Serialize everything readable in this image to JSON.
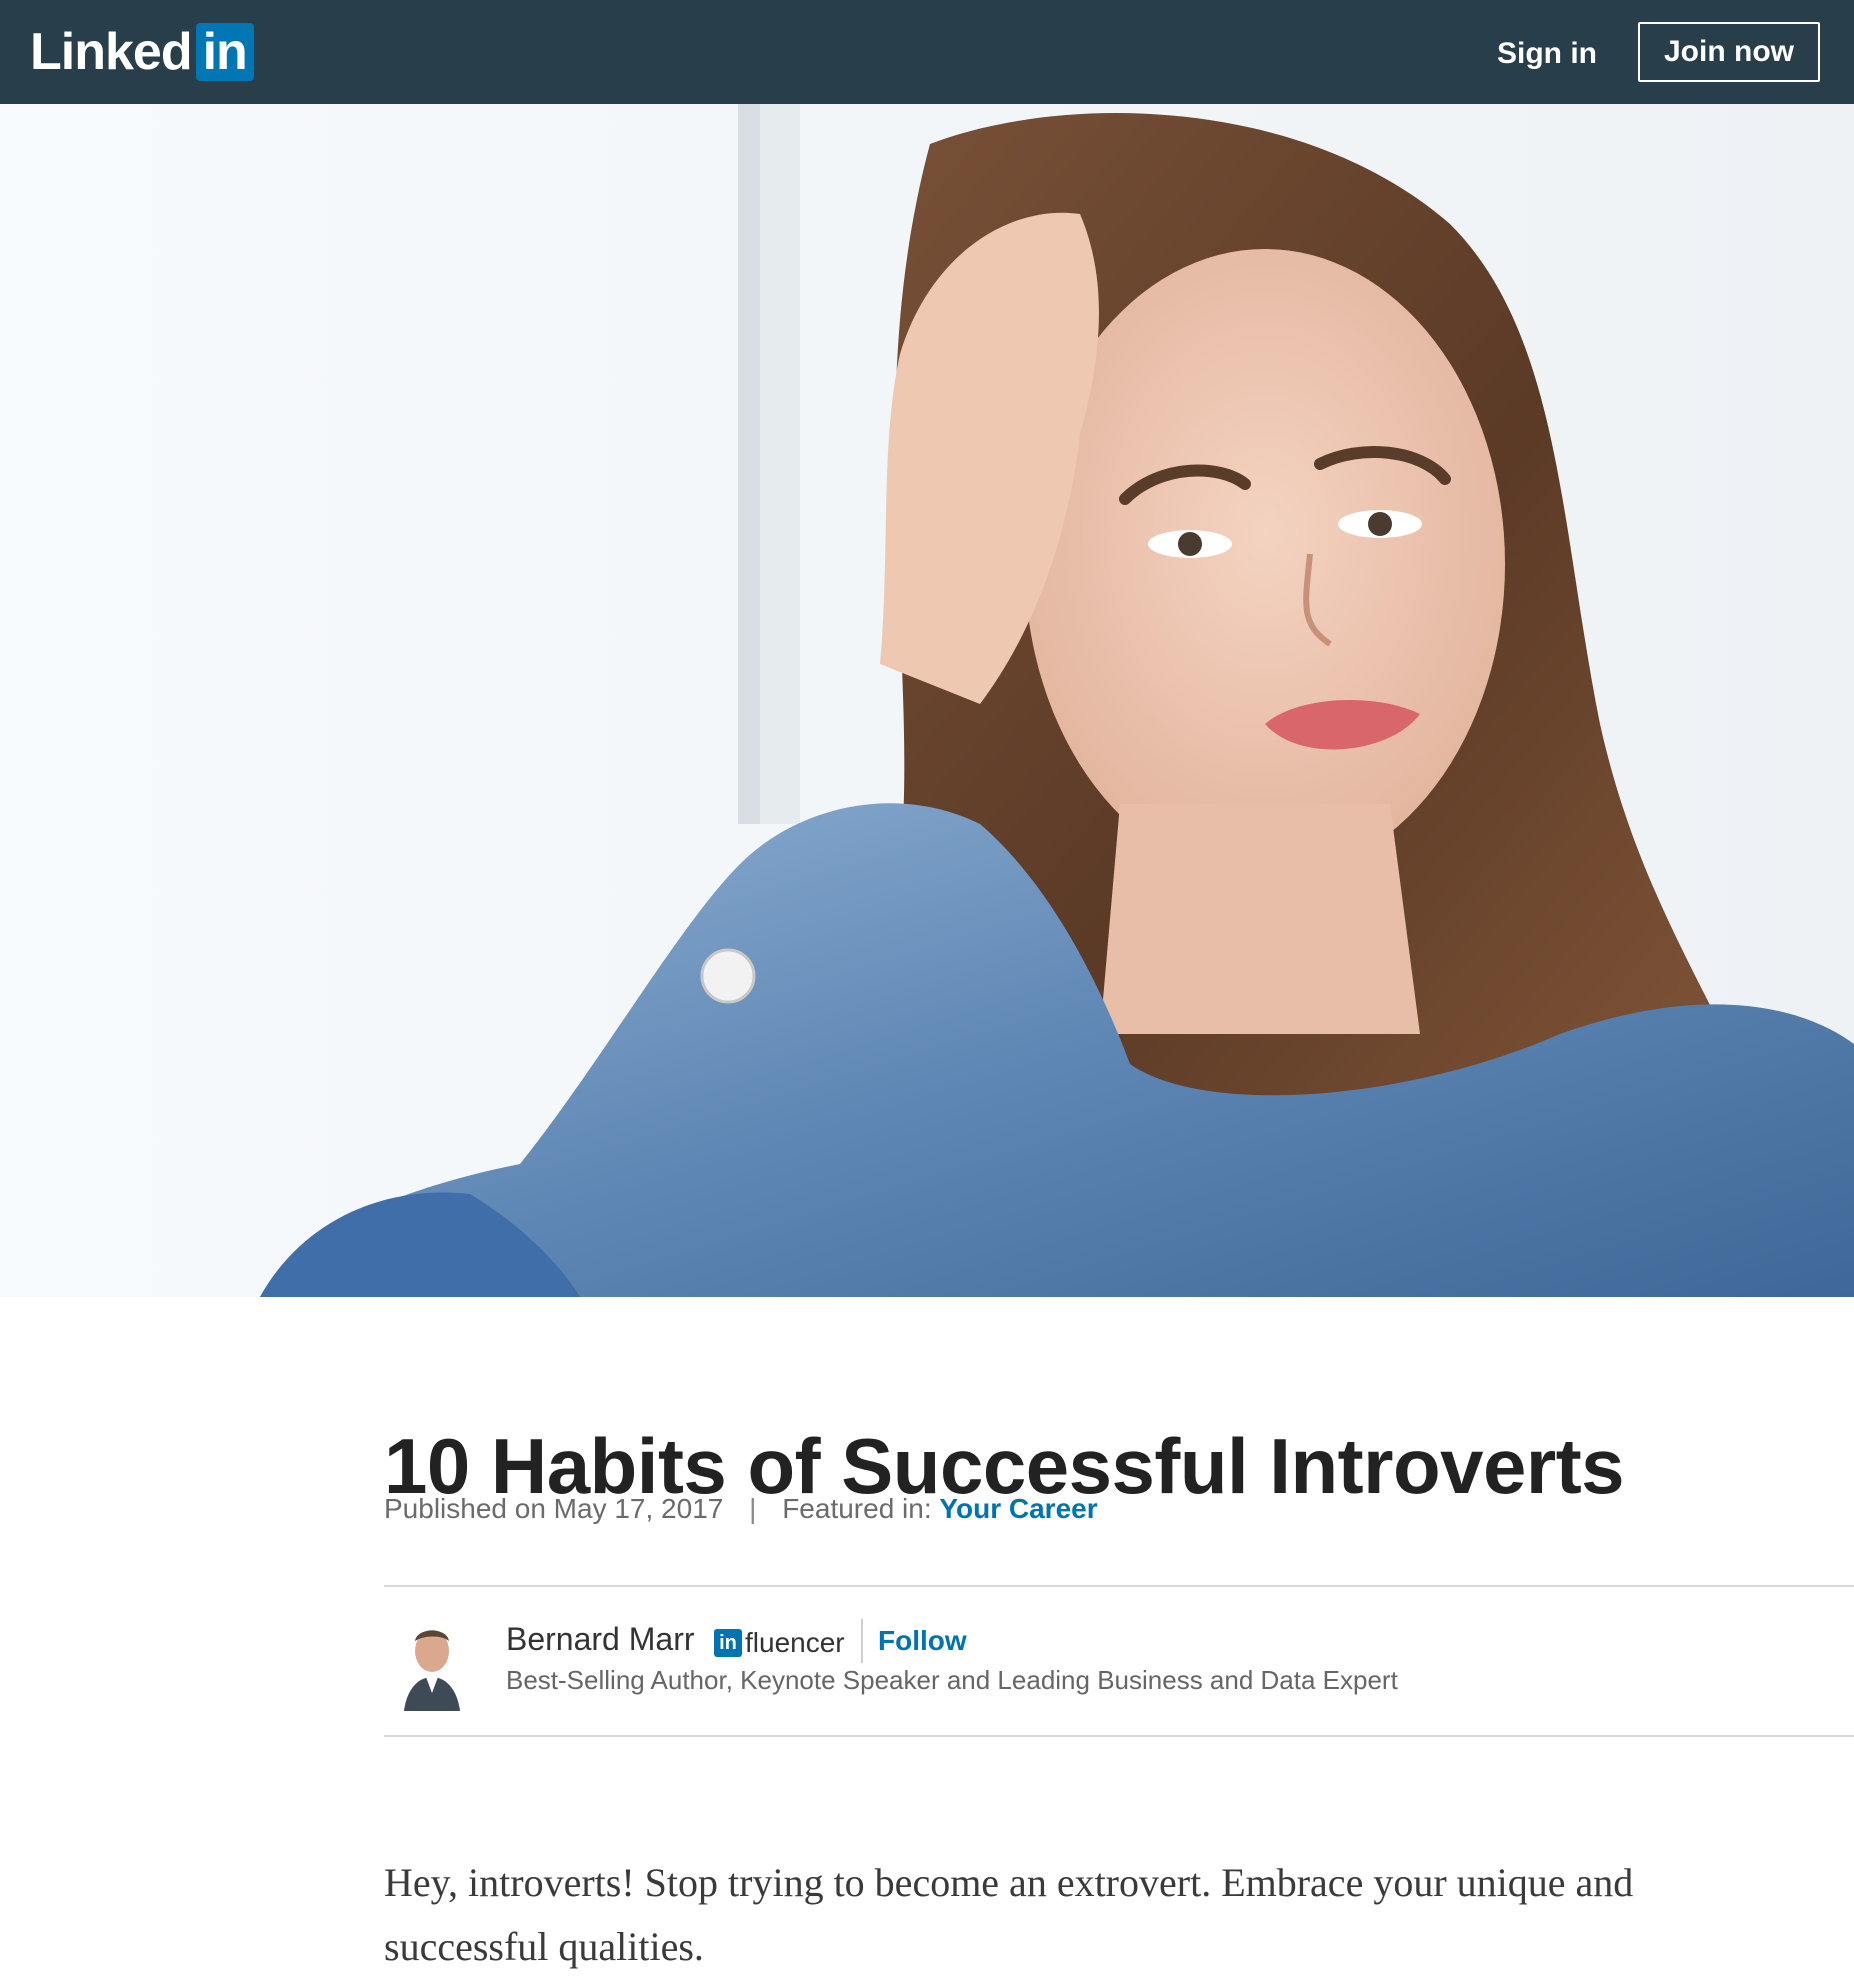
{
  "header": {
    "logo_text": "Linked",
    "logo_box_text": "in",
    "sign_in_label": "Sign in",
    "join_now_label": "Join now",
    "bar_color": "#283e4a",
    "brand_blue": "#0073b1"
  },
  "article": {
    "title": "10 Habits of Successful Introverts",
    "published": "Published on May 17, 2017",
    "separator": "|",
    "featured_label": "Featured in:",
    "featured_link": "Your Career"
  },
  "author": {
    "name": "Bernard Marr",
    "badge_box_text": "in",
    "badge_text": "fluencer",
    "follow_label": "Follow",
    "headline": "Best-Selling Author, Keynote Speaker and Leading Business and Data Expert"
  },
  "body": {
    "intro": "Hey, introverts! Stop trying to become an extrovert. Embrace your unique and successful qualities."
  }
}
